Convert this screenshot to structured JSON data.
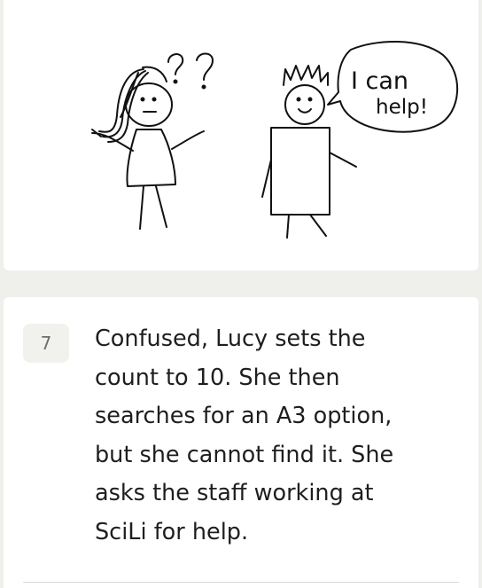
{
  "illustration": {
    "figure_left_marks": "??",
    "speech_line_1": "I can",
    "speech_line_2": "help!"
  },
  "step": {
    "number": "7",
    "text": "Confused, Lucy sets the count to 10. She then searches for an A3 option, but she cannot find it. She asks the staff working at SciLi for help."
  }
}
